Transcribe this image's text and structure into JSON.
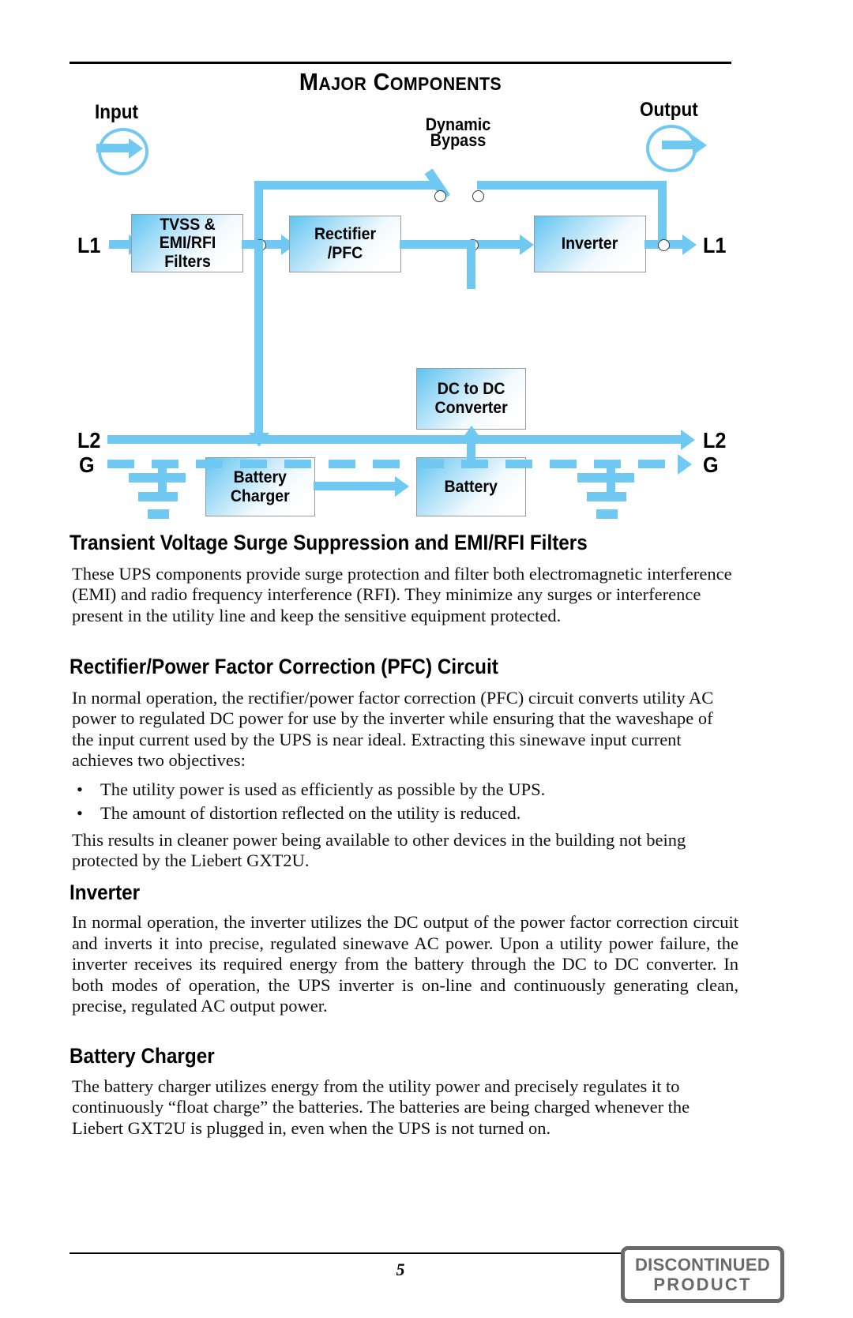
{
  "document": {
    "title_small_caps_lead": "M",
    "title_rest_1": "AJOR",
    "title_small_caps_lead2": "C",
    "title_rest_2": "OMPONENTS",
    "title_full": "MAJOR COMPONENTS",
    "page_number": "5"
  },
  "diagram": {
    "input_label": "Input",
    "output_label": "Output",
    "bypass_label_line1": "Dynamic",
    "bypass_label_line2": "Bypass",
    "l1_left": "L1",
    "l1_right": "L1",
    "l2_left": "L2",
    "l2_right": "L2",
    "g_left": "G",
    "g_right": "G",
    "boxes": [
      {
        "id": "tvss",
        "lines": [
          "TVSS &",
          "EMI/RFI",
          "Filters"
        ]
      },
      {
        "id": "rectifier",
        "lines": [
          "Rectifier",
          "/PFC"
        ]
      },
      {
        "id": "inverter",
        "lines": [
          "Inverter"
        ]
      },
      {
        "id": "dcdc",
        "lines": [
          "DC to DC",
          "Converter"
        ]
      },
      {
        "id": "charger",
        "lines": [
          "Battery",
          "Charger"
        ]
      },
      {
        "id": "battery",
        "lines": [
          "Battery"
        ]
      }
    ],
    "accent_color": "#6FC9F3",
    "box_border_color": "#9A9A9A"
  },
  "sections": [
    {
      "heading": "Transient Voltage Surge Suppression and EMI/RFI Filters",
      "body": "These UPS components provide surge protection and filter both electromagnetic interference (EMI) and radio frequency interference (RFI). They minimize any surges or interference present in the utility line and keep the sensitive equipment protected."
    },
    {
      "heading": "Rectifier/Power Factor Correction (PFC) Circuit",
      "body": "In normal operation, the rectifier/power factor correction (PFC) circuit converts utility AC power to regulated DC power for use by the inverter while ensuring that the waveshape of the input current used by the UPS is near ideal. Extracting this sinewave input current achieves two objectives:",
      "bullets": [
        "The utility power is used as efficiently as possible by the UPS.",
        "The amount of distortion reflected on the utility is reduced."
      ],
      "body_after": "This results in cleaner power being available to other devices in the building not being protected by the Liebert GXT2U."
    },
    {
      "heading": "Inverter",
      "body": "In normal operation, the inverter utilizes the DC output of the power factor correction circuit and inverts it into precise, regulated sinewave AC power. Upon a utility power failure, the inverter receives its required energy from the battery through the DC to DC converter. In both modes of operation, the UPS inverter is on-line and continuously generating clean, precise, regulated AC output power."
    },
    {
      "heading": "Battery Charger",
      "body": "The battery charger utilizes energy from the utility power and precisely regulates it to continuously “float charge” the batteries. The batteries are being charged whenever the Liebert GXT2U is plugged in, even when the UPS is not turned on."
    }
  ],
  "footer": {
    "stamp_line1": "DISCONTINUED",
    "stamp_line2": "PRODUCT",
    "stamp_color": "#6A6A6A"
  },
  "bullet_glyph": "•"
}
